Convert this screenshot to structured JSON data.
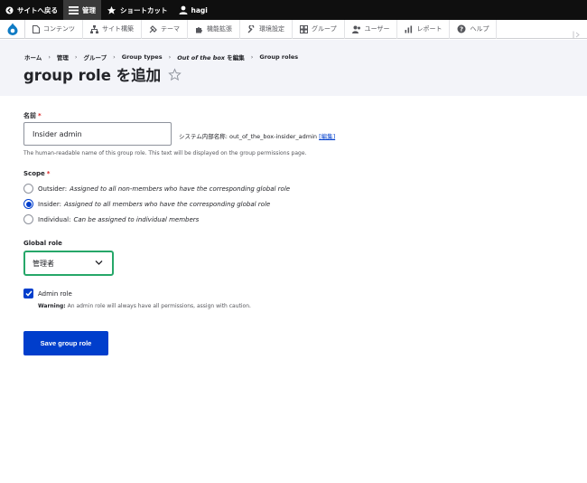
{
  "toolbar": {
    "back_label": "サイトへ戻る",
    "manage_label": "管理",
    "shortcuts_label": "ショートカット",
    "user_label": "hagi"
  },
  "menu": {
    "items": [
      {
        "label": "コンテンツ",
        "icon": "document-icon"
      },
      {
        "label": "サイト構築",
        "icon": "sitemap-icon"
      },
      {
        "label": "テーマ",
        "icon": "brush-icon"
      },
      {
        "label": "機能拡張",
        "icon": "puzzle-icon"
      },
      {
        "label": "環境設定",
        "icon": "wrench-icon"
      },
      {
        "label": "グループ",
        "icon": "group-icon"
      },
      {
        "label": "ユーザー",
        "icon": "users-icon"
      },
      {
        "label": "レポート",
        "icon": "chart-icon"
      },
      {
        "label": "ヘルプ",
        "icon": "help-icon"
      }
    ]
  },
  "breadcrumb": {
    "items": [
      "ホーム",
      "管理",
      "グループ",
      "Group types"
    ],
    "edit_italic": "Out of the box",
    "edit_suffix": " を編集",
    "last": "Group roles"
  },
  "page": {
    "title": "group role を追加"
  },
  "form": {
    "name": {
      "label": "名前",
      "required_mark": "*",
      "value": "Insider admin",
      "machine_prefix": "システム内部名称: out_of_the_box-insider_admin ",
      "machine_edit": "[編集]",
      "description": "The human-readable name of this group role. This text will be displayed on the group permissions page."
    },
    "scope": {
      "label": "Scope",
      "required_mark": "*",
      "options": [
        {
          "title": "Outsider:",
          "desc": "Assigned to all non-members who have the corresponding global role",
          "selected": false
        },
        {
          "title": "Insider:",
          "desc": "Assigned to all members who have the corresponding global role",
          "selected": true
        },
        {
          "title": "Individual:",
          "desc": "Can be assigned to individual members",
          "selected": false
        }
      ]
    },
    "global_role": {
      "label": "Global role",
      "value": "管理者"
    },
    "admin_role": {
      "label": "Admin role",
      "checked": true,
      "warning_label": "Warning:",
      "warning_text": " An admin role will always have all permissions, assign with caution."
    },
    "save_label": "Save group role"
  },
  "colors": {
    "accent": "#003ecc",
    "focus": "#26a769",
    "required": "#dc2323",
    "toolbar": "#0f0f0f",
    "header_bg": "#f3f4f9"
  }
}
